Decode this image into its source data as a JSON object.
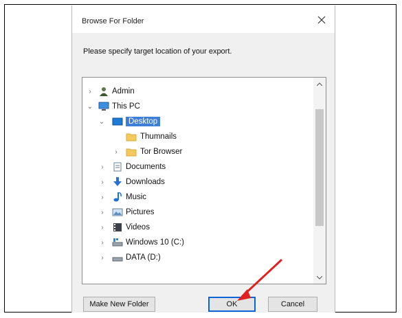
{
  "dialog": {
    "title": "Browse For Folder",
    "instruction": "Please specify target location of your export.",
    "close_glyph": "✕"
  },
  "tree": {
    "items": [
      {
        "label": "Admin",
        "icon": "user-icon",
        "expander": "›"
      },
      {
        "label": "This PC",
        "icon": "computer-icon",
        "expander": "⌄"
      },
      {
        "label": "Desktop",
        "icon": "desktop-folder-icon",
        "expander": "⌄",
        "selected": true
      },
      {
        "label": "Thumnails",
        "icon": "folder-icon",
        "expander": ""
      },
      {
        "label": "Tor Browser",
        "icon": "folder-icon",
        "expander": "›"
      },
      {
        "label": "Documents",
        "icon": "documents-icon",
        "expander": "›"
      },
      {
        "label": "Downloads",
        "icon": "downloads-icon",
        "expander": "›"
      },
      {
        "label": "Music",
        "icon": "music-icon",
        "expander": "›"
      },
      {
        "label": "Pictures",
        "icon": "pictures-icon",
        "expander": "›"
      },
      {
        "label": "Videos",
        "icon": "videos-icon",
        "expander": "›"
      },
      {
        "label": "Windows 10 (C:)",
        "icon": "windows-drive-icon",
        "expander": "›"
      },
      {
        "label": "DATA (D:)",
        "icon": "drive-icon",
        "expander": "›"
      }
    ]
  },
  "buttons": {
    "make_new_folder": "Make New Folder",
    "ok": "OK",
    "cancel": "Cancel"
  },
  "colors": {
    "selection": "#3d7fd6",
    "annotation_arrow": "#e02020",
    "folder": "#f4c95d"
  }
}
